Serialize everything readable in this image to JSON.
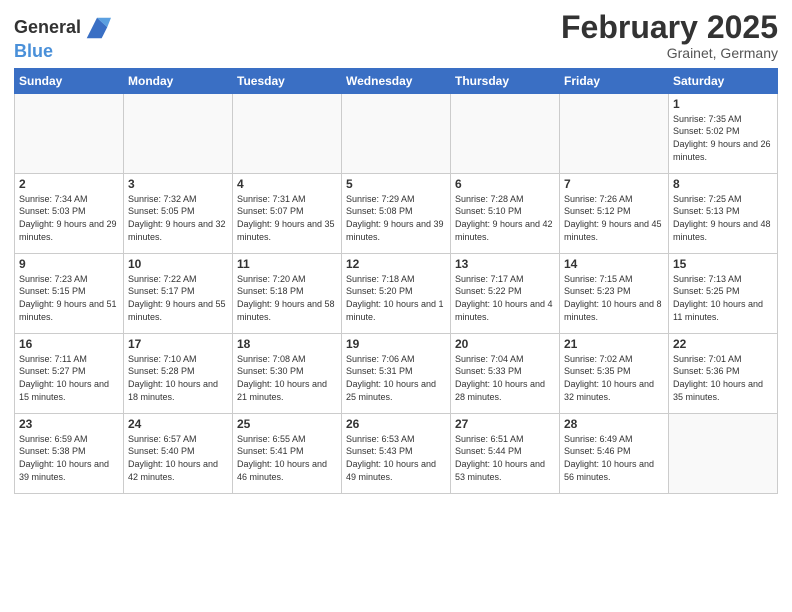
{
  "header": {
    "logo_line1": "General",
    "logo_line2": "Blue",
    "month_year": "February 2025",
    "location": "Grainet, Germany"
  },
  "weekdays": [
    "Sunday",
    "Monday",
    "Tuesday",
    "Wednesday",
    "Thursday",
    "Friday",
    "Saturday"
  ],
  "weeks": [
    [
      {
        "day": "",
        "info": ""
      },
      {
        "day": "",
        "info": ""
      },
      {
        "day": "",
        "info": ""
      },
      {
        "day": "",
        "info": ""
      },
      {
        "day": "",
        "info": ""
      },
      {
        "day": "",
        "info": ""
      },
      {
        "day": "1",
        "info": "Sunrise: 7:35 AM\nSunset: 5:02 PM\nDaylight: 9 hours\nand 26 minutes."
      }
    ],
    [
      {
        "day": "2",
        "info": "Sunrise: 7:34 AM\nSunset: 5:03 PM\nDaylight: 9 hours\nand 29 minutes."
      },
      {
        "day": "3",
        "info": "Sunrise: 7:32 AM\nSunset: 5:05 PM\nDaylight: 9 hours\nand 32 minutes."
      },
      {
        "day": "4",
        "info": "Sunrise: 7:31 AM\nSunset: 5:07 PM\nDaylight: 9 hours\nand 35 minutes."
      },
      {
        "day": "5",
        "info": "Sunrise: 7:29 AM\nSunset: 5:08 PM\nDaylight: 9 hours\nand 39 minutes."
      },
      {
        "day": "6",
        "info": "Sunrise: 7:28 AM\nSunset: 5:10 PM\nDaylight: 9 hours\nand 42 minutes."
      },
      {
        "day": "7",
        "info": "Sunrise: 7:26 AM\nSunset: 5:12 PM\nDaylight: 9 hours\nand 45 minutes."
      },
      {
        "day": "8",
        "info": "Sunrise: 7:25 AM\nSunset: 5:13 PM\nDaylight: 9 hours\nand 48 minutes."
      }
    ],
    [
      {
        "day": "9",
        "info": "Sunrise: 7:23 AM\nSunset: 5:15 PM\nDaylight: 9 hours\nand 51 minutes."
      },
      {
        "day": "10",
        "info": "Sunrise: 7:22 AM\nSunset: 5:17 PM\nDaylight: 9 hours\nand 55 minutes."
      },
      {
        "day": "11",
        "info": "Sunrise: 7:20 AM\nSunset: 5:18 PM\nDaylight: 9 hours\nand 58 minutes."
      },
      {
        "day": "12",
        "info": "Sunrise: 7:18 AM\nSunset: 5:20 PM\nDaylight: 10 hours\nand 1 minute."
      },
      {
        "day": "13",
        "info": "Sunrise: 7:17 AM\nSunset: 5:22 PM\nDaylight: 10 hours\nand 4 minutes."
      },
      {
        "day": "14",
        "info": "Sunrise: 7:15 AM\nSunset: 5:23 PM\nDaylight: 10 hours\nand 8 minutes."
      },
      {
        "day": "15",
        "info": "Sunrise: 7:13 AM\nSunset: 5:25 PM\nDaylight: 10 hours\nand 11 minutes."
      }
    ],
    [
      {
        "day": "16",
        "info": "Sunrise: 7:11 AM\nSunset: 5:27 PM\nDaylight: 10 hours\nand 15 minutes."
      },
      {
        "day": "17",
        "info": "Sunrise: 7:10 AM\nSunset: 5:28 PM\nDaylight: 10 hours\nand 18 minutes."
      },
      {
        "day": "18",
        "info": "Sunrise: 7:08 AM\nSunset: 5:30 PM\nDaylight: 10 hours\nand 21 minutes."
      },
      {
        "day": "19",
        "info": "Sunrise: 7:06 AM\nSunset: 5:31 PM\nDaylight: 10 hours\nand 25 minutes."
      },
      {
        "day": "20",
        "info": "Sunrise: 7:04 AM\nSunset: 5:33 PM\nDaylight: 10 hours\nand 28 minutes."
      },
      {
        "day": "21",
        "info": "Sunrise: 7:02 AM\nSunset: 5:35 PM\nDaylight: 10 hours\nand 32 minutes."
      },
      {
        "day": "22",
        "info": "Sunrise: 7:01 AM\nSunset: 5:36 PM\nDaylight: 10 hours\nand 35 minutes."
      }
    ],
    [
      {
        "day": "23",
        "info": "Sunrise: 6:59 AM\nSunset: 5:38 PM\nDaylight: 10 hours\nand 39 minutes."
      },
      {
        "day": "24",
        "info": "Sunrise: 6:57 AM\nSunset: 5:40 PM\nDaylight: 10 hours\nand 42 minutes."
      },
      {
        "day": "25",
        "info": "Sunrise: 6:55 AM\nSunset: 5:41 PM\nDaylight: 10 hours\nand 46 minutes."
      },
      {
        "day": "26",
        "info": "Sunrise: 6:53 AM\nSunset: 5:43 PM\nDaylight: 10 hours\nand 49 minutes."
      },
      {
        "day": "27",
        "info": "Sunrise: 6:51 AM\nSunset: 5:44 PM\nDaylight: 10 hours\nand 53 minutes."
      },
      {
        "day": "28",
        "info": "Sunrise: 6:49 AM\nSunset: 5:46 PM\nDaylight: 10 hours\nand 56 minutes."
      },
      {
        "day": "",
        "info": ""
      }
    ]
  ]
}
